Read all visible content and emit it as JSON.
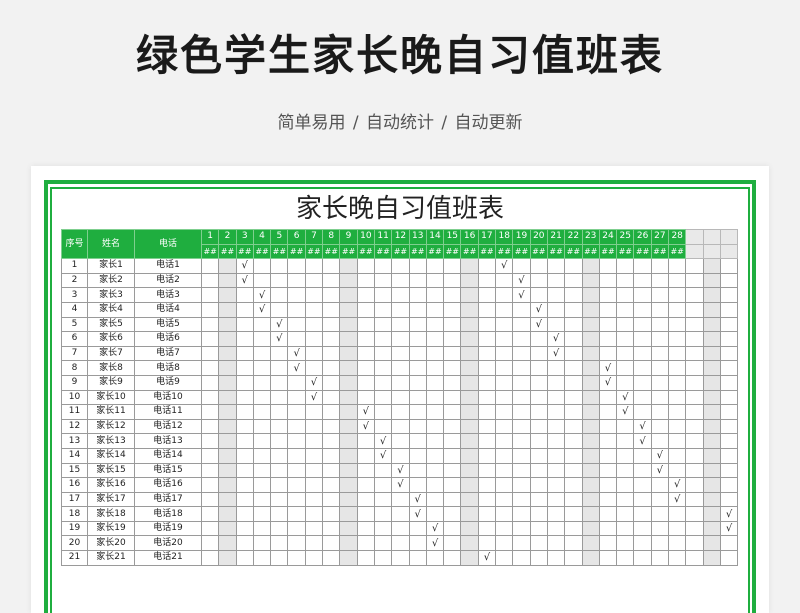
{
  "page": {
    "title": "绿色学生家长晚自习值班表",
    "subtitle": "简单易用 / 自动统计 / 自动更新"
  },
  "sheet": {
    "table_title": "家长晚自习值班表",
    "headers": {
      "index": "序号",
      "name": "姓名",
      "phone": "电话"
    },
    "day_numbers": [
      "1",
      "2",
      "3",
      "4",
      "5",
      "6",
      "7",
      "8",
      "9",
      "10",
      "11",
      "12",
      "13",
      "14",
      "15",
      "16",
      "17",
      "18",
      "19",
      "20",
      "21",
      "22",
      "23",
      "24",
      "25",
      "26",
      "27",
      "28"
    ],
    "day_sublabel": "##",
    "blank_day_columns": 3,
    "shaded_columns": [
      2,
      9,
      16,
      23,
      30
    ],
    "check_mark": "√",
    "rows": [
      {
        "index": "1",
        "name": "家长1",
        "phone": "电话1",
        "checks": [
          3,
          18
        ]
      },
      {
        "index": "2",
        "name": "家长2",
        "phone": "电话2",
        "checks": [
          3,
          19
        ]
      },
      {
        "index": "3",
        "name": "家长3",
        "phone": "电话3",
        "checks": [
          4,
          19
        ]
      },
      {
        "index": "4",
        "name": "家长4",
        "phone": "电话4",
        "checks": [
          4,
          20
        ]
      },
      {
        "index": "5",
        "name": "家长5",
        "phone": "电话5",
        "checks": [
          5,
          20
        ]
      },
      {
        "index": "6",
        "name": "家长6",
        "phone": "电话6",
        "checks": [
          5,
          21
        ]
      },
      {
        "index": "7",
        "name": "家长7",
        "phone": "电话7",
        "checks": [
          6,
          21
        ]
      },
      {
        "index": "8",
        "name": "家长8",
        "phone": "电话8",
        "checks": [
          6,
          24
        ]
      },
      {
        "index": "9",
        "name": "家长9",
        "phone": "电话9",
        "checks": [
          7,
          24
        ]
      },
      {
        "index": "10",
        "name": "家长10",
        "phone": "电话10",
        "checks": [
          7,
          25
        ]
      },
      {
        "index": "11",
        "name": "家长11",
        "phone": "电话11",
        "checks": [
          10,
          25
        ]
      },
      {
        "index": "12",
        "name": "家长12",
        "phone": "电话12",
        "checks": [
          10,
          26
        ]
      },
      {
        "index": "13",
        "name": "家长13",
        "phone": "电话13",
        "checks": [
          11,
          26
        ]
      },
      {
        "index": "14",
        "name": "家长14",
        "phone": "电话14",
        "checks": [
          11,
          27
        ]
      },
      {
        "index": "15",
        "name": "家长15",
        "phone": "电话15",
        "checks": [
          12,
          27
        ]
      },
      {
        "index": "16",
        "name": "家长16",
        "phone": "电话16",
        "checks": [
          12,
          28
        ]
      },
      {
        "index": "17",
        "name": "家长17",
        "phone": "电话17",
        "checks": [
          13,
          28
        ]
      },
      {
        "index": "18",
        "name": "家长18",
        "phone": "电话18",
        "checks": [
          13,
          31
        ]
      },
      {
        "index": "19",
        "name": "家长19",
        "phone": "电话19",
        "checks": [
          14,
          31
        ]
      },
      {
        "index": "20",
        "name": "家长20",
        "phone": "电话20",
        "checks": [
          14
        ]
      },
      {
        "index": "21",
        "name": "家长21",
        "phone": "电话21",
        "checks": [
          17
        ]
      }
    ]
  },
  "colors": {
    "accent": "#1fae3f",
    "shade": "#e6e6e6",
    "background": "#f2f2f2"
  }
}
